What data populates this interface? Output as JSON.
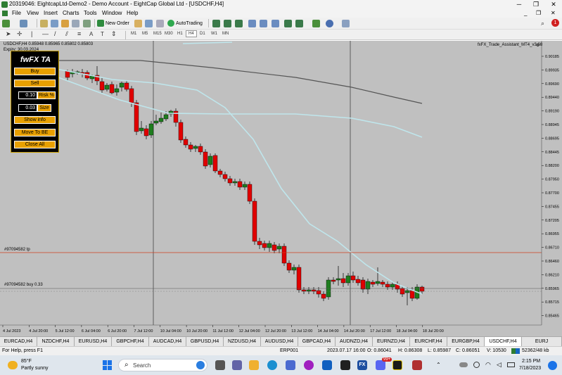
{
  "window": {
    "title": "20319046: EightcapLtd-Demo2 - Demo Account - EightCap Global Ltd - [USDCHF,H4]"
  },
  "menu": [
    "File",
    "View",
    "Insert",
    "Charts",
    "Tools",
    "Window",
    "Help"
  ],
  "toolbar": {
    "new_order": "New Order",
    "autotrading": "AutoTrading"
  },
  "timeframes": [
    "M1",
    "M5",
    "M15",
    "M30",
    "H1",
    "H4",
    "D1",
    "W1",
    "MN"
  ],
  "chart": {
    "header": "USDCHF,H4  0.85948 0.85965 0.85802 0.85803",
    "expiry": "Expiry: 30.03.2024",
    "indicator": "fxFX_Trade_Assistant_MT4_v3.08",
    "level_tp": "#97094582 tp",
    "level_buy": "#97094582 buy 0.33",
    "current_price": "0.85803",
    "price_axis": [
      "0.90185",
      "0.89935",
      "0.89690",
      "0.89440",
      "0.89190",
      "0.88945",
      "0.88695",
      "0.88445",
      "0.88200",
      "0.87950",
      "0.87700",
      "0.87455",
      "0.87205",
      "0.86955",
      "0.86710",
      "0.86460",
      "0.86210",
      "0.85965",
      "0.85715",
      "0.85465"
    ],
    "time_axis": [
      "4 Jul 2023",
      "4 Jul 20:00",
      "5 Jul 12:00",
      "6 Jul 04:00",
      "6 Jul 20:00",
      "7 Jul 12:00",
      "10 Jul 04:00",
      "10 Jul 20:00",
      "11 Jul 12:00",
      "12 Jul 04:00",
      "12 Jul 20:00",
      "13 Jul 12:00",
      "14 Jul 04:00",
      "14 Jul 20:00",
      "17 Jul 12:00",
      "18 Jul 04:00",
      "18 Jul 20:00"
    ]
  },
  "trade_assistant": {
    "title": "fwFX TA",
    "buy": "Buy",
    "sell": "Sell",
    "risk_value": "0.10",
    "risk_label": "Risk %",
    "size_value": "0.03",
    "size_label": "Size",
    "show_info": "Show info",
    "move_to_be": "Move To BE",
    "close_all": "Close All"
  },
  "symbol_tabs": [
    "EURCAD,H4",
    "NZDCHF,H4",
    "EURUSD,H4",
    "GBPCHF,H4",
    "AUDCAD,H4",
    "GBPUSD,H4",
    "NZDUSD,H4",
    "AUDUSD,H4",
    "GBPCAD,H4",
    "AUDNZD,H4",
    "EURNZD,H4",
    "EURCHF,H4",
    "EURGBP,H4",
    "USDCHF,H4",
    "EURJ"
  ],
  "active_tab": "USDCHF,H4",
  "status": {
    "help": "For Help, press F1",
    "profile": "ERP001",
    "datetime": "2023.07.17 16:00",
    "open": "O: 0.86041",
    "high": "H: 0.86308",
    "low": "L: 0.85987",
    "close": "C: 0.86051",
    "volume": "V: 10530",
    "traffic": "52362/48 kb"
  },
  "taskbar": {
    "temp": "85°F",
    "weather": "Partly sunny",
    "search": "Search",
    "time": "2:15 PM",
    "date": "7/18/2023",
    "badge": "99+"
  },
  "colors": {
    "bull": "#1e7d1e",
    "bear": "#e00000",
    "ma_slow": "#555555",
    "ma_fast": "#bfe6ec",
    "tp_line": "#d04020",
    "panel": "#e8a000"
  }
}
